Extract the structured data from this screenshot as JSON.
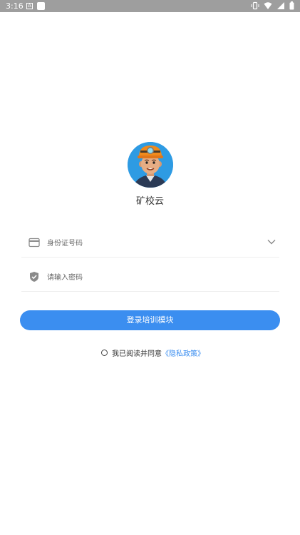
{
  "status_bar": {
    "time": "3:16",
    "notification_icons": [
      "a-icon",
      "square-icon"
    ],
    "system_icons": [
      "vibrate-icon",
      "wifi-icon",
      "signal-icon",
      "battery-icon"
    ]
  },
  "app": {
    "name": "矿校云",
    "avatar_icon": "miner-avatar-icon"
  },
  "form": {
    "id_field": {
      "placeholder": "身份证号码",
      "icon": "card-icon",
      "dropdown_icon": "chevron-down-icon"
    },
    "password_field": {
      "placeholder": "请输入密码",
      "icon": "shield-check-icon"
    },
    "login_button": "登录培训模块"
  },
  "agreement": {
    "text": "我已阅读并同意",
    "link": "《隐私政策》"
  },
  "colors": {
    "accent": "#3b8ef0",
    "status_bar": "#9e9e9e"
  }
}
